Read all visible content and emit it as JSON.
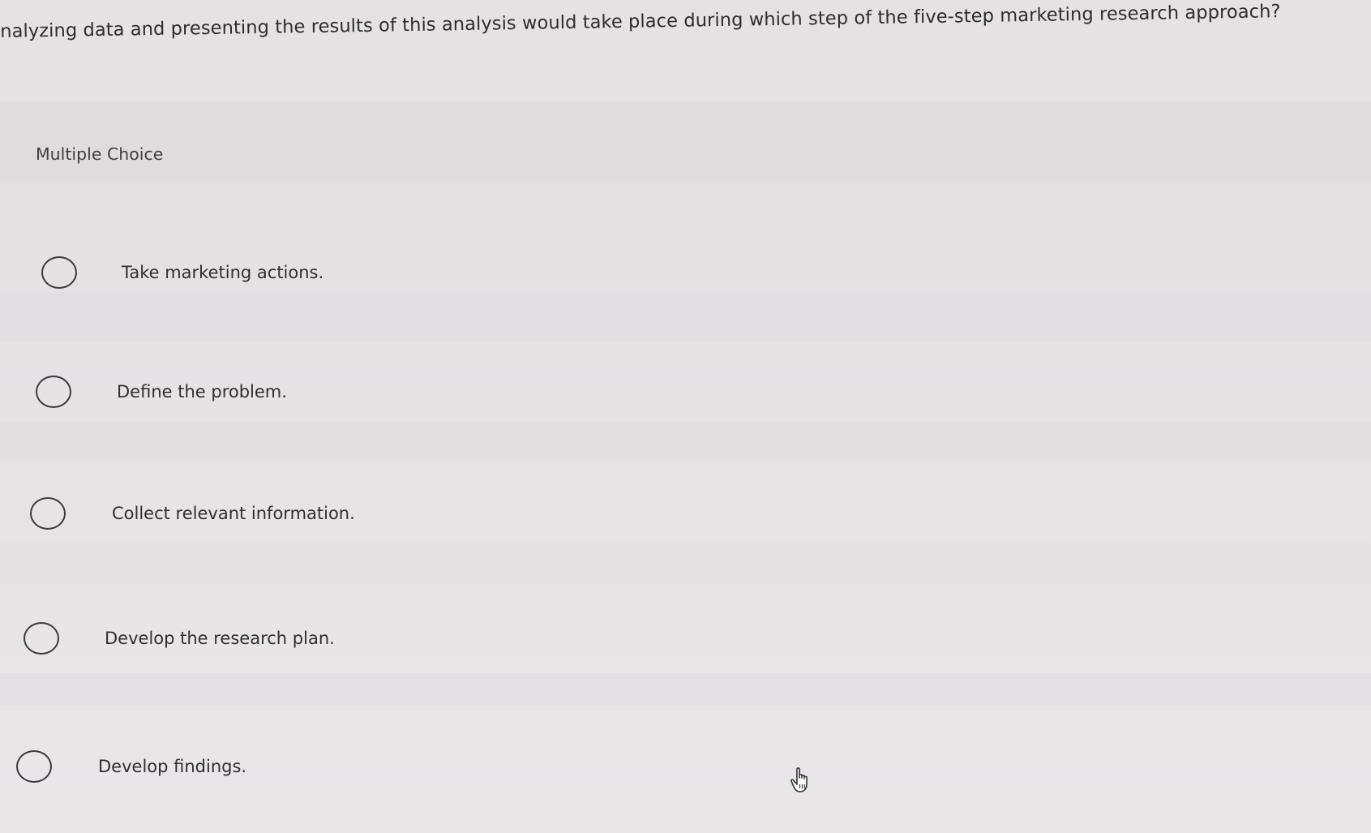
{
  "question": {
    "text": "nalyzing data and presenting the results of this analysis would take place during which step of the five-step marketing research approach?"
  },
  "question_type": {
    "label": "Multiple Choice"
  },
  "options": [
    {
      "label": "Take marketing actions."
    },
    {
      "label": "Define the problem."
    },
    {
      "label": "Collect relevant information."
    },
    {
      "label": "Develop the research plan."
    },
    {
      "label": "Develop findings."
    }
  ],
  "cursor": {
    "icon": "hand-pointer-icon"
  }
}
